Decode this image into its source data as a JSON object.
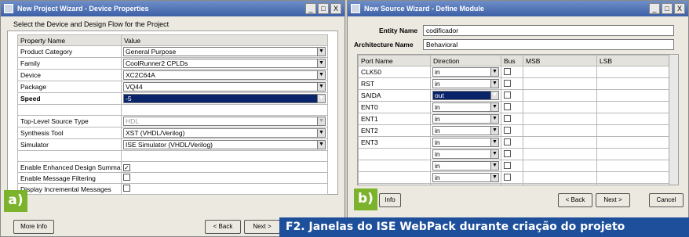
{
  "windowA": {
    "title": "New Project Wizard - Device Properties",
    "heading": "Select the Device and Design Flow for the Project",
    "columns": [
      "Property Name",
      "Value"
    ],
    "rows": [
      {
        "name": "Product Category",
        "value": "General Purpose"
      },
      {
        "name": "Family",
        "value": "CoolRunner2 CPLDs"
      },
      {
        "name": "Device",
        "value": "XC2C64A"
      },
      {
        "name": "Package",
        "value": "VQ44"
      },
      {
        "name": "Speed",
        "value": "-5"
      },
      {
        "name": "",
        "value": ""
      },
      {
        "name": "Top-Level Source Type",
        "value": "HDL"
      },
      {
        "name": "Synthesis Tool",
        "value": "XST (VHDL/Verilog)"
      },
      {
        "name": "Simulator",
        "value": "ISE Simulator (VHDL/Verilog)"
      },
      {
        "name": "",
        "value": ""
      },
      {
        "name": "Enable Enhanced Design Summary",
        "value": ""
      },
      {
        "name": "Enable Message Filtering",
        "value": ""
      },
      {
        "name": "Display Incremental Messages",
        "value": ""
      }
    ],
    "badge": "a)",
    "buttons": {
      "more_info": "More Info",
      "back": "< Back",
      "next": "Next >"
    },
    "controls": {
      "min": "_",
      "max": "□",
      "close": "X"
    }
  },
  "windowB": {
    "title": "New Source Wizard - Define Module",
    "entity_label": "Entity Name",
    "entity_value": "codificador",
    "arch_label": "Architecture Name",
    "arch_value": "Behavioral",
    "columns": [
      "Port Name",
      "Direction",
      "Bus",
      "MSB",
      "LSB"
    ],
    "ports": [
      {
        "name": "CLK50",
        "dir": "in"
      },
      {
        "name": "RST",
        "dir": "in"
      },
      {
        "name": "SAIDA",
        "dir": "out"
      },
      {
        "name": "ENT0",
        "dir": "in"
      },
      {
        "name": "ENT1",
        "dir": "in"
      },
      {
        "name": "ENT2",
        "dir": "in"
      },
      {
        "name": "ENT3",
        "dir": "in"
      },
      {
        "name": "",
        "dir": "in"
      },
      {
        "name": "",
        "dir": "in"
      },
      {
        "name": "",
        "dir": "in"
      },
      {
        "name": "",
        "dir": "in"
      }
    ],
    "badge": "b)",
    "buttons": {
      "info": "Info",
      "back": "< Back",
      "next": "Next >",
      "cancel": "Cancel"
    },
    "controls": {
      "min": "_",
      "max": "□",
      "close": "X"
    }
  },
  "caption": "F2. Janelas do ISE WebPack durante criação do projeto"
}
